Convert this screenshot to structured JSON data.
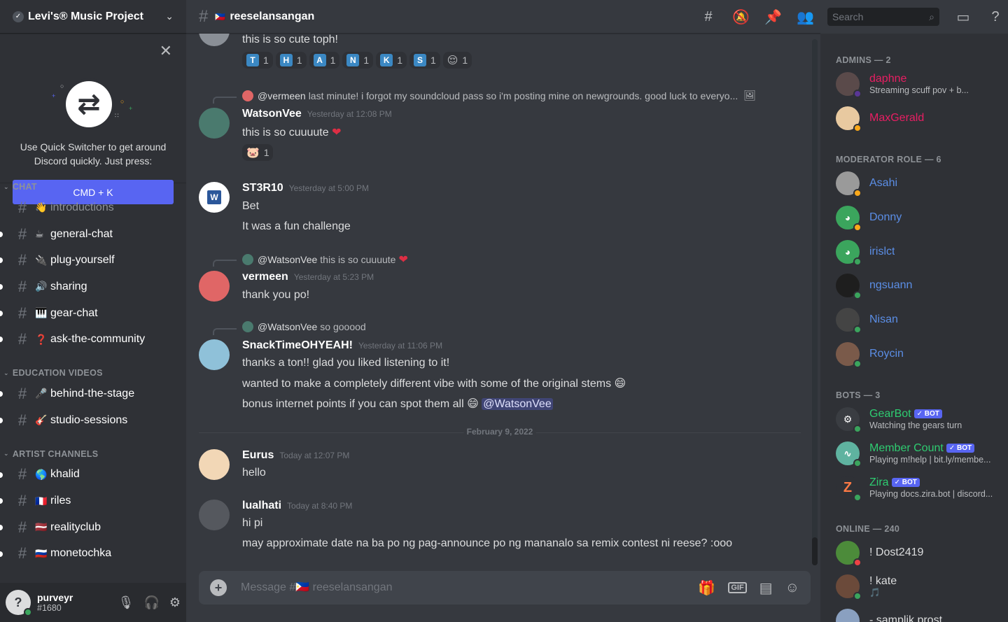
{
  "server": {
    "name": "Levi's® Music Project"
  },
  "quick_switcher": {
    "text": "Use Quick Switcher to get around Discord quickly. Just press:",
    "button": "CMD + K"
  },
  "categories": [
    {
      "name": "CHAT",
      "channels": [
        {
          "name": "introductions",
          "emoji": "👋",
          "unread": false
        },
        {
          "name": "general-chat",
          "emoji": "☕",
          "unread": true
        },
        {
          "name": "plug-yourself",
          "emoji": "🔌",
          "unread": true
        },
        {
          "name": "sharing",
          "emoji": "🔊",
          "unread": true
        },
        {
          "name": "gear-chat",
          "emoji": "🎹",
          "unread": true
        },
        {
          "name": "ask-the-community",
          "emoji": "❓",
          "unread": true
        }
      ]
    },
    {
      "name": "EDUCATION VIDEOS",
      "channels": [
        {
          "name": "behind-the-stage",
          "emoji": "🎤",
          "unread": true
        },
        {
          "name": "studio-sessions",
          "emoji": "🎸",
          "unread": true
        }
      ]
    },
    {
      "name": "ARTIST CHANNELS",
      "channels": [
        {
          "name": "khalid",
          "emoji": "🌎",
          "unread": true
        },
        {
          "name": "riles",
          "emoji": "🇫🇷",
          "unread": true
        },
        {
          "name": "realityclub",
          "emoji": "🇱🇻",
          "unread": true
        },
        {
          "name": "monetochka",
          "emoji": "🇷🇺",
          "unread": true
        }
      ]
    }
  ],
  "user": {
    "name": "purveyr",
    "tag": "#1680"
  },
  "channel": {
    "name": "reeselansangan",
    "flag": "🇵🇭"
  },
  "search": {
    "placeholder": "Search"
  },
  "composer": {
    "placeholder": "Message #🇵🇭 reeselansangan"
  },
  "messages": {
    "m0": {
      "text": "this is so cute toph!",
      "reactions": [
        {
          "letter": "T",
          "count": "1"
        },
        {
          "letter": "H",
          "count": "1"
        },
        {
          "letter": "A",
          "count": "1"
        },
        {
          "letter": "N",
          "count": "1"
        },
        {
          "letter": "K",
          "count": "1"
        },
        {
          "letter": "S",
          "count": "1"
        },
        {
          "emoji": "😌",
          "count": "1"
        }
      ]
    },
    "m1": {
      "reply_name": "@vermeen",
      "reply_text": "last minute! i forgot my soundcloud pass so i'm posting mine on newgrounds. good luck to everyo...",
      "author": "WatsonVee",
      "time": "Yesterday at 12:08 PM",
      "text": "this is so cuuuute",
      "reaction": {
        "emoji": "🐷",
        "count": "1"
      }
    },
    "m2": {
      "author": "ST3R10",
      "time": "Yesterday at 5:00 PM",
      "line1": "Bet",
      "line2": "It was a fun challenge"
    },
    "m3": {
      "reply_name": "@WatsonVee",
      "reply_text": "this is so cuuuute",
      "author": "vermeen",
      "time": "Yesterday at 5:23 PM",
      "text": "thank you po!"
    },
    "m4": {
      "reply_name": "@WatsonVee",
      "reply_text": "so gooood",
      "author": "SnackTimeOHYEAH!",
      "time": "Yesterday at 11:06 PM",
      "line1": "thanks a ton!! glad you liked listening to it!",
      "line2": "wanted to make a completely different vibe with some of the original stems",
      "line3": "bonus internet points if you can spot them all",
      "mention": "@WatsonVee"
    },
    "divider": "February 9, 2022",
    "m5": {
      "author": "Eurus",
      "time": "Today at 12:07 PM",
      "text": "hello"
    },
    "m6": {
      "author": "lualhati",
      "time": "Today at 8:40 PM",
      "line1": "hi pi",
      "line2": "may approximate date na ba po ng pag-announce po ng mananalo sa remix contest ni reese? :ooo"
    }
  },
  "members": {
    "admins_header": "ADMINS — 2",
    "daphne": {
      "name": "daphne",
      "activity": "Streaming scuff pov + b...",
      "color": "#e91e63"
    },
    "maxgerald": {
      "name": "MaxGerald",
      "color": "#e91e63"
    },
    "moderator_header": "MODERATOR ROLE — 6",
    "mods": [
      "Asahi",
      "Donny",
      "irislct",
      "ngsuann",
      "Nisan",
      "Roycin"
    ],
    "mod_color": "#5b8ee6",
    "bots_header": "BOTS — 3",
    "bot_label": "BOT",
    "bot_color": "#2ecc71",
    "bots": [
      {
        "name": "GearBot",
        "activity": "Watching the gears turn"
      },
      {
        "name": "Member Count",
        "activity": "Playing m!help | bit.ly/membe..."
      },
      {
        "name": "Zira",
        "activity": "Playing docs.zira.bot | discord..."
      }
    ],
    "online_header": "ONLINE — 240",
    "online": [
      {
        "name": "! Dost2419"
      },
      {
        "name": "! kate"
      },
      {
        "name": "- samplik prost"
      }
    ]
  }
}
